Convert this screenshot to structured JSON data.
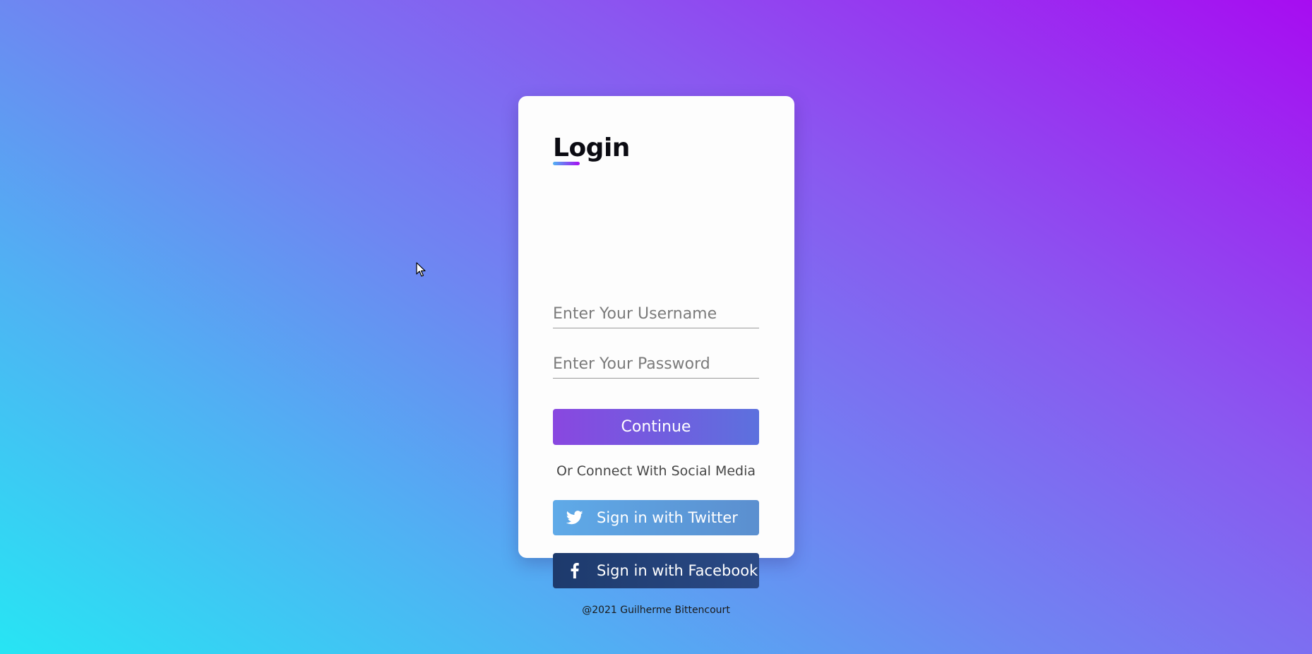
{
  "background": {
    "gradient_colors": [
      "#27e5f3",
      "#6f85f2",
      "#a70cf1"
    ]
  },
  "login": {
    "title": "Login",
    "username_placeholder": "Enter Your Username",
    "password_placeholder": "Enter Your Password",
    "continue_label": "Continue",
    "social_prompt": "Or Connect With Social Media",
    "twitter_label": "Sign in with Twitter",
    "twitter_icon": "twitter-bird-icon",
    "facebook_label": "Sign in with Facebook",
    "facebook_icon": "facebook-f-icon",
    "footer": "@2021 Guilherme Bittencourt"
  },
  "colors": {
    "continue_start": "#8947e0",
    "continue_end": "#5c71de",
    "twitter": "#5faae8",
    "facebook": "#1d3a6c"
  }
}
